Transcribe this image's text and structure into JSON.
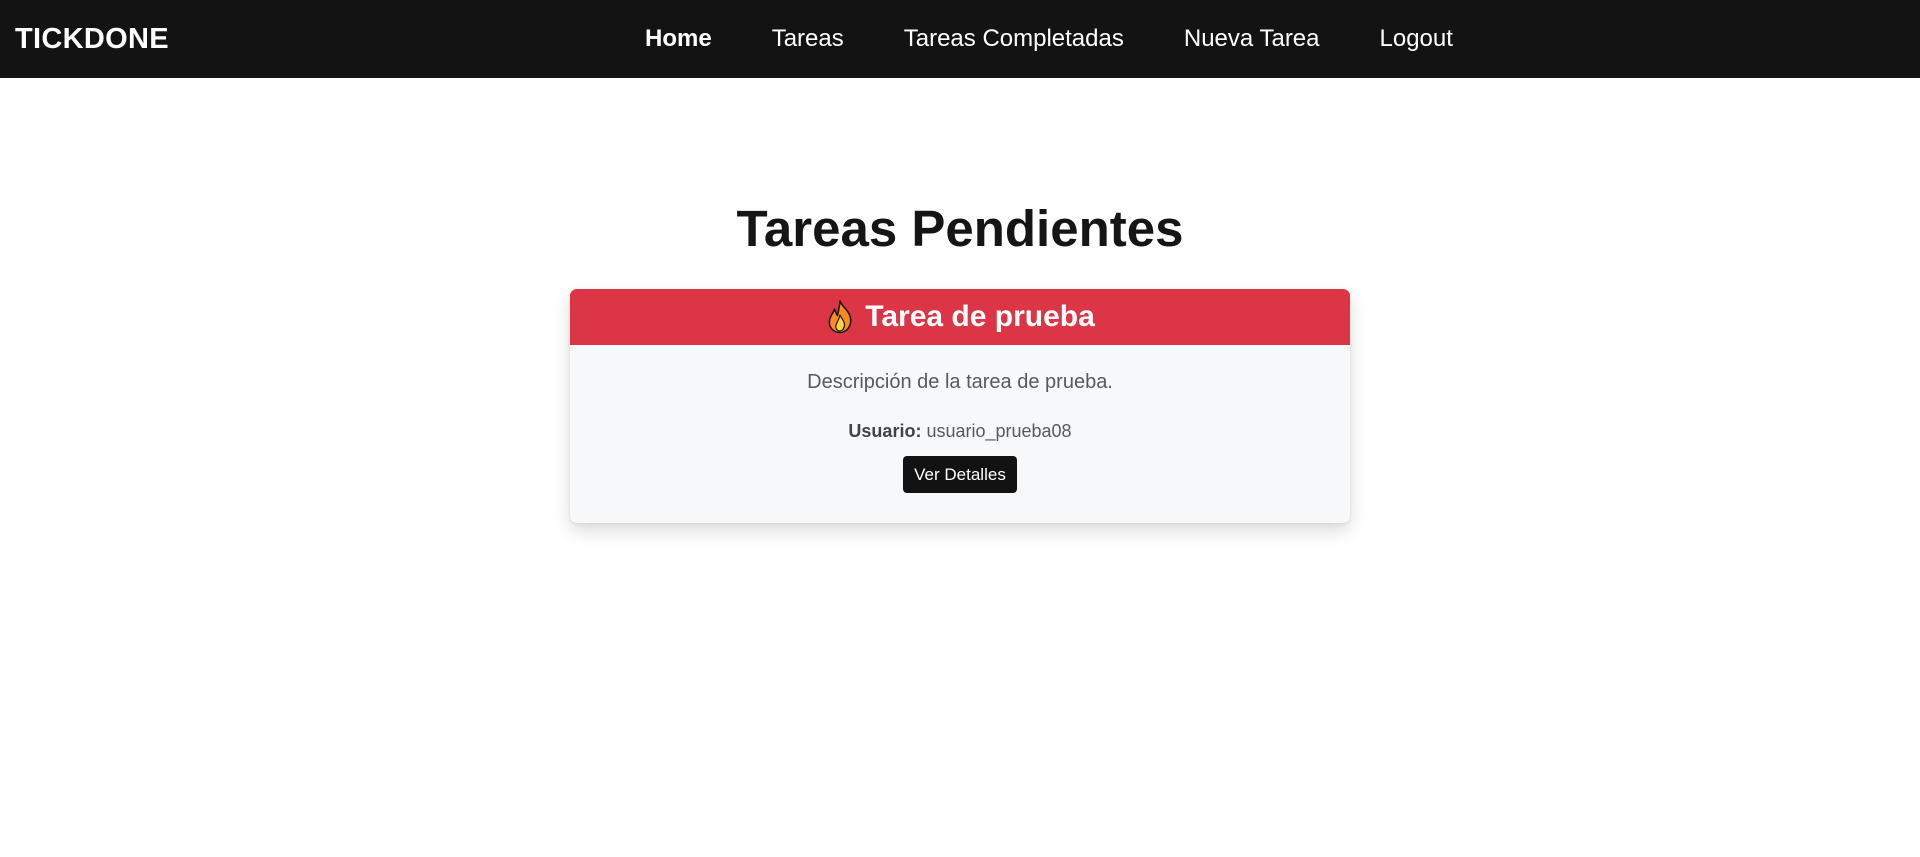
{
  "navbar": {
    "brand": "TICKDONE",
    "links": [
      {
        "label": "Home",
        "active": true
      },
      {
        "label": "Tareas",
        "active": false
      },
      {
        "label": "Tareas Completadas",
        "active": false
      },
      {
        "label": "Nueva Tarea",
        "active": false
      },
      {
        "label": "Logout",
        "active": false
      }
    ]
  },
  "main": {
    "title": "Tareas Pendientes",
    "tasks": [
      {
        "icon": "fire-icon",
        "title": "Tarea de prueba",
        "description": "Descripción de la tarea de prueba.",
        "user_label": "Usuario:",
        "user": "usuario_prueba08",
        "button_label": "Ver Detalles",
        "header_color": "#dc3545"
      }
    ]
  },
  "colors": {
    "navbar_bg": "#131313",
    "card_bg": "#f7f8fa",
    "button_bg": "#121212"
  }
}
